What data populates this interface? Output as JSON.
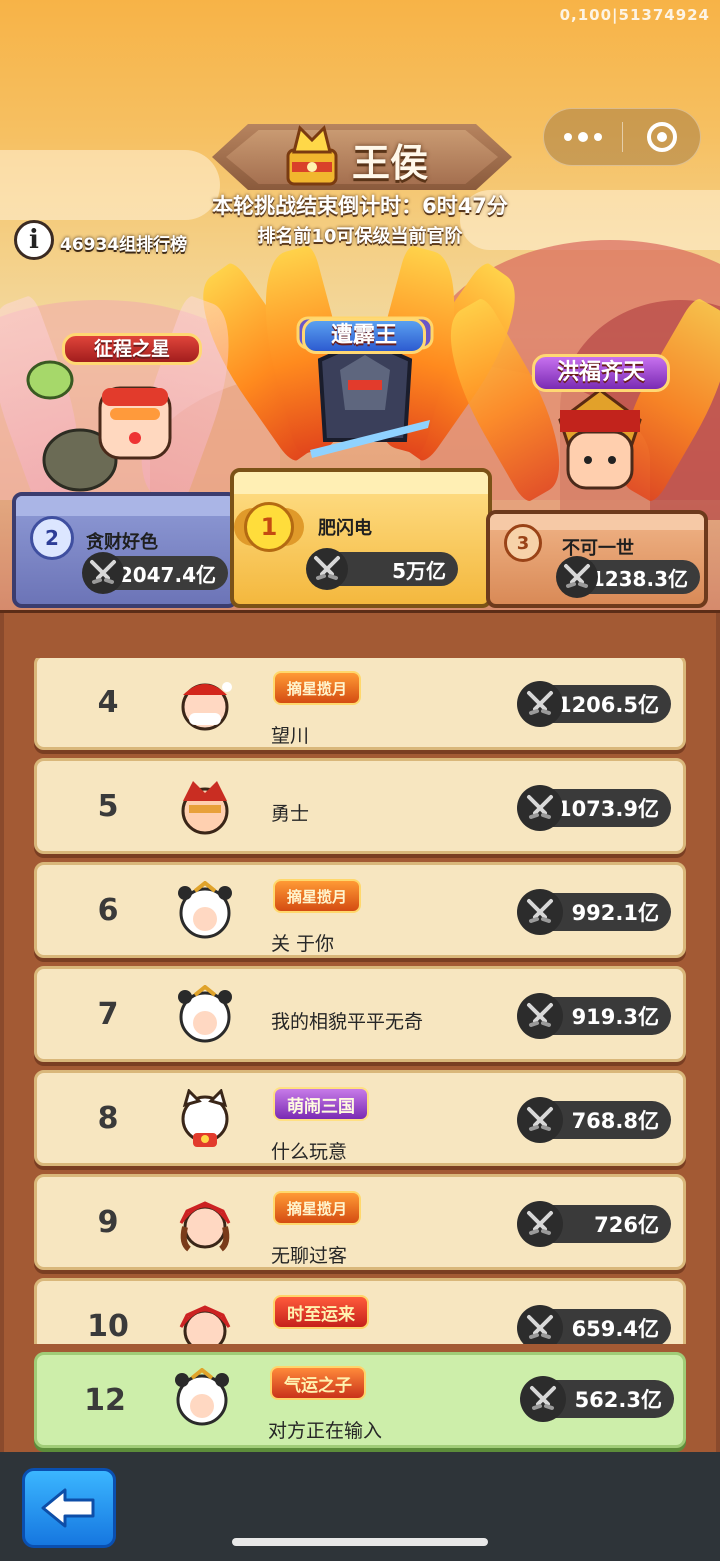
{
  "build_id": "0,100|51374924",
  "header": {
    "rank_title": "王侯",
    "countdown": "本轮挑战结束倒计时：6时47分",
    "hint": "排名前10可保级当前官阶",
    "group_count": "46934组排行榜",
    "info_icon": "i"
  },
  "podium": {
    "first": {
      "rank": "1",
      "name": "肥闪电",
      "power": "5万亿",
      "title_badge": "遭霹王"
    },
    "second": {
      "rank": "2",
      "name": "贪财好色",
      "power": "2047.4亿",
      "title_badge": "征程之星"
    },
    "third": {
      "rank": "3",
      "name": "不可一世",
      "power": "1238.3亿",
      "title_badge": "洪福齐天"
    }
  },
  "rows": [
    {
      "rank": "4",
      "name": "望川",
      "honor": "摘星揽月",
      "power": "1206.5亿"
    },
    {
      "rank": "5",
      "name": "勇士",
      "honor": "",
      "power": "1073.9亿"
    },
    {
      "rank": "6",
      "name": "关 于你",
      "honor": "摘星揽月",
      "power": "992.1亿"
    },
    {
      "rank": "7",
      "name": "我的相貌平平无奇",
      "honor": "",
      "power": "919.3亿"
    },
    {
      "rank": "8",
      "name": "什么玩意",
      "honor": "萌闹三国",
      "power": "768.8亿"
    },
    {
      "rank": "9",
      "name": "无聊过客",
      "honor": "摘星揽月",
      "power": "726亿"
    },
    {
      "rank": "10",
      "name": "",
      "honor": "时至运来",
      "power": "659.4亿"
    }
  ],
  "self": {
    "rank": "12",
    "name": "对方正在输入",
    "honor": "气运之子",
    "power": "562.3亿"
  },
  "colors": {
    "row_bg": "#f7e6c0",
    "self_bg": "#cdeeaa",
    "board": "#a35a34",
    "pill": "#3a3a3a"
  }
}
